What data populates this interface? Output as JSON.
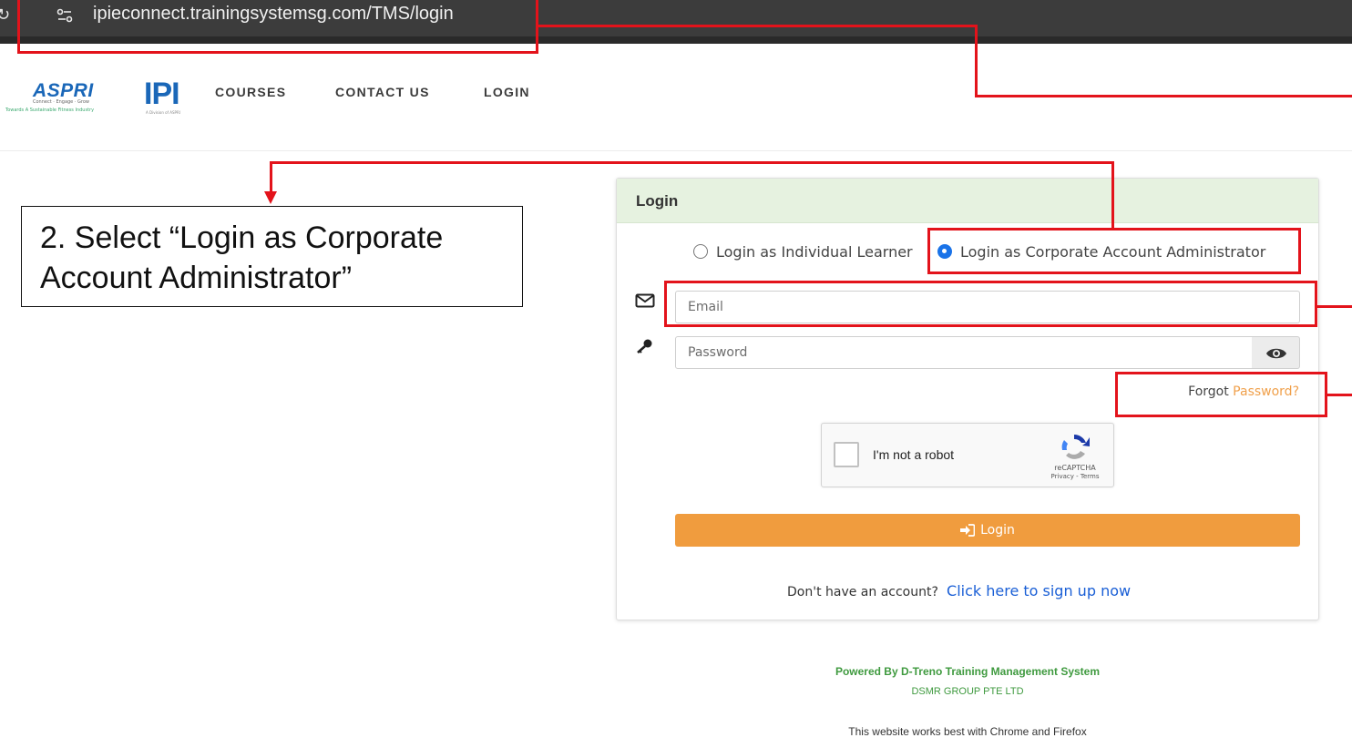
{
  "browser": {
    "url": "ipieconnect.trainingsystemsg.com/TMS/login"
  },
  "navbar": {
    "logo_aspri": {
      "brand": "ASPRI",
      "tagline": "Connect · Engage · Grow",
      "subtag": "Towards A Sustainable Fitness Industry"
    },
    "logo_ipi": {
      "brand": "IPI",
      "subtag": "A Division of ASPRI"
    },
    "links": [
      "COURSES",
      "CONTACT US",
      "LOGIN"
    ]
  },
  "login_card": {
    "title": "Login",
    "radio_options": [
      {
        "label": "Login as Individual Learner",
        "selected": false
      },
      {
        "label": "Login as Corporate Account Administrator",
        "selected": true
      }
    ],
    "email_placeholder": "Email",
    "password_placeholder": "Password",
    "forgot_prefix": "Forgot",
    "forgot_link": "Password?",
    "captcha": {
      "label": "I'm not a robot",
      "brand": "reCAPTCHA",
      "terms": "Privacy - Terms"
    },
    "login_button": "Login",
    "signup_question": "Don't have an account?",
    "signup_link": "Click here to sign up now"
  },
  "footer": {
    "powered_by": "Powered By D-Treno Training Management System",
    "company": "DSMR GROUP PTE LTD",
    "note": "This website works best with Chrome and Firefox"
  },
  "annotation": {
    "callout_line1": "2. Select “Login as Corporate",
    "callout_line2": "Account Administrator”"
  },
  "colors": {
    "accent_orange": "#f09c3e",
    "link_blue": "#1a5fd6",
    "annotation_red": "#e3131b",
    "header_green": "#e6f2e0",
    "footer_green": "#3f9a3f"
  }
}
